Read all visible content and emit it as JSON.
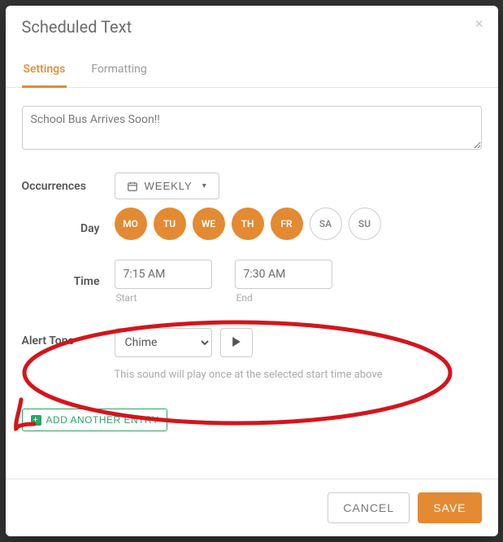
{
  "header": {
    "title": "Scheduled Text"
  },
  "tabs": {
    "settings": "Settings",
    "formatting": "Formatting"
  },
  "message": {
    "value": "School Bus Arrives Soon!!"
  },
  "occurrences": {
    "label": "Occurrences",
    "frequency": "WEEKLY"
  },
  "day": {
    "label": "Day",
    "items": [
      {
        "code": "MO",
        "on": true
      },
      {
        "code": "TU",
        "on": true
      },
      {
        "code": "WE",
        "on": true
      },
      {
        "code": "TH",
        "on": true
      },
      {
        "code": "FR",
        "on": true
      },
      {
        "code": "SA",
        "on": false
      },
      {
        "code": "SU",
        "on": false
      }
    ]
  },
  "time": {
    "label": "Time",
    "start": {
      "value": "7:15 AM",
      "caption": "Start"
    },
    "end": {
      "value": "7:30 AM",
      "caption": "End"
    }
  },
  "tone": {
    "label": "Alert Tone",
    "selected": "Chime",
    "hint": "This sound will play once at the selected start time above"
  },
  "add_entry": "ADD ANOTHER ENTRY",
  "footer": {
    "cancel": "CANCEL",
    "save": "SAVE"
  }
}
